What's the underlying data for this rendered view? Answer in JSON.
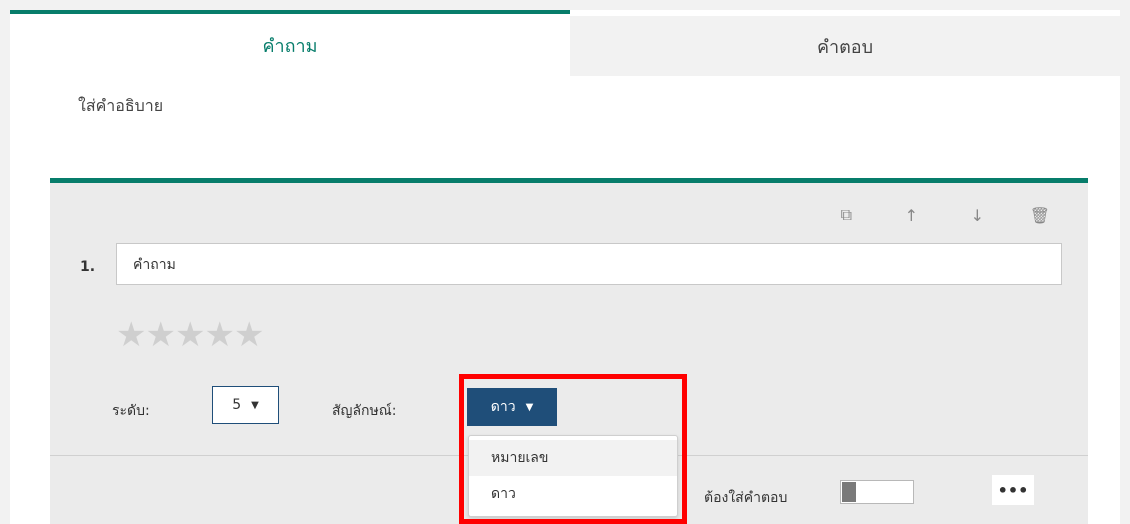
{
  "tabs": {
    "question": "คำถาม",
    "answer": "คำตอบ"
  },
  "description_placeholder": "ใส่คำอธิบาย",
  "question": {
    "number": "1.",
    "value": "คำถาม",
    "tools": [
      "copy-icon",
      "move-up-icon",
      "move-down-icon",
      "delete-icon"
    ],
    "stars_count": 5,
    "star_glyph": "★"
  },
  "rating": {
    "level_label": "ระดับ:",
    "level_value": "5",
    "symbol_label": "สัญลักษณ์:",
    "symbol_value": "ดาว",
    "caret": "▼",
    "options": [
      "หมายเลข",
      "ดาว"
    ]
  },
  "footer": {
    "required_label": "ต้องใส่คำตอบ",
    "more_label": "•••"
  },
  "colors": {
    "accent": "#077d6b",
    "select_dark": "#1f4e79",
    "highlight": "#ff0000"
  }
}
